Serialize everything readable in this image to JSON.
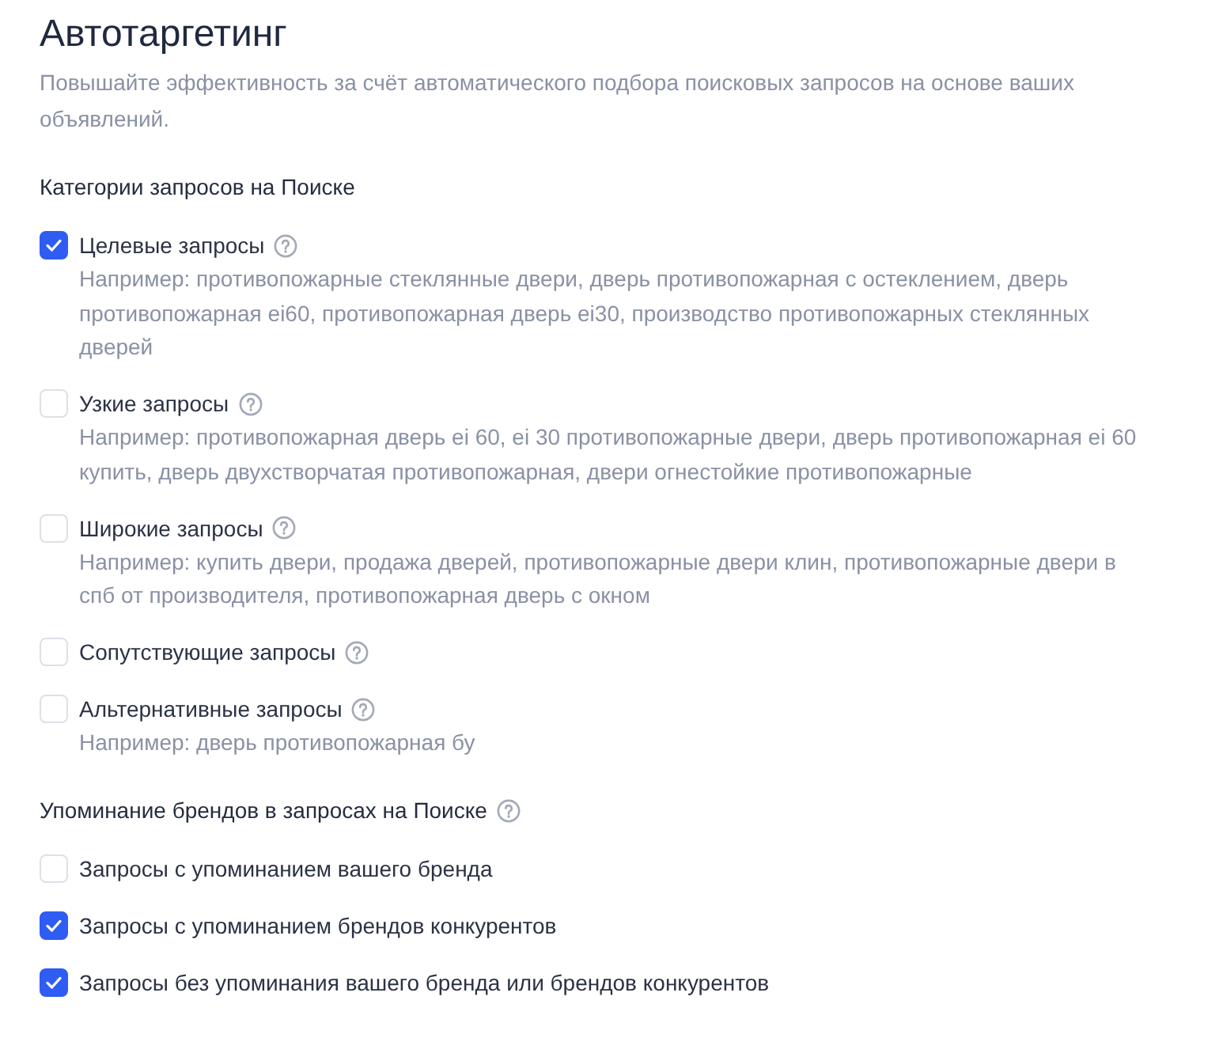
{
  "title": "Автотаргетинг",
  "description": "Повышайте эффективность за счёт автоматического подбора поисковых запросов на основе ваших объявлений.",
  "sections": [
    {
      "heading": "Категории запросов на Поиске",
      "has_help": false,
      "options": [
        {
          "label": "Целевые запросы",
          "checked": true,
          "has_help": true,
          "example": "Например: противопожарные стеклянные двери, дверь противопожарная с остеклением, дверь противопожарная ei60, противопожарная дверь ei30, производство противопожарных стеклянных дверей"
        },
        {
          "label": "Узкие запросы",
          "checked": false,
          "has_help": true,
          "example": "Например: противопожарная дверь ei 60, ei 30 противопожарные двери, дверь противопожарная ei 60 купить, дверь двухстворчатая противопожарная, двери огнестойкие противопожарные"
        },
        {
          "label": "Широкие запросы",
          "checked": false,
          "has_help": true,
          "example": "Например: купить двери, продажа дверей, противопожарные двери клин, противопожарные двери в спб от производителя, противопожарная дверь с окном"
        },
        {
          "label": "Сопутствующие запросы",
          "checked": false,
          "has_help": true
        },
        {
          "label": "Альтернативные запросы",
          "checked": false,
          "has_help": true,
          "example": "Например: дверь противопожарная бу"
        }
      ]
    },
    {
      "heading": "Упоминание брендов в запросах на Поиске",
      "has_help": true,
      "options": [
        {
          "label": "Запросы с упоминанием вашего бренда",
          "checked": false,
          "has_help": false
        },
        {
          "label": "Запросы с упоминанием брендов конкурентов",
          "checked": true,
          "has_help": false
        },
        {
          "label": "Запросы без упоминания вашего бренда или брендов конкурентов",
          "checked": true,
          "has_help": false
        }
      ]
    }
  ]
}
